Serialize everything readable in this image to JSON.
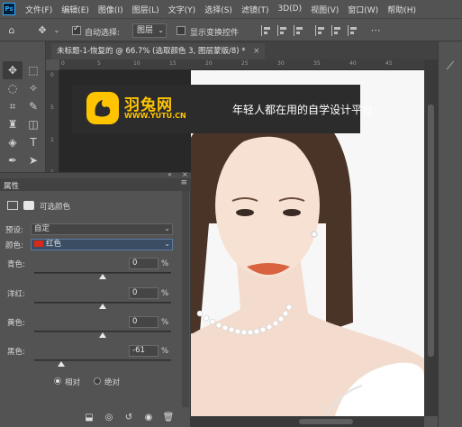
{
  "menu": {
    "logo": "Ps",
    "items": [
      "文件(F)",
      "编辑(E)",
      "图像(I)",
      "图层(L)",
      "文字(Y)",
      "选择(S)",
      "滤镜(T)",
      "3D(D)",
      "视图(V)",
      "窗口(W)",
      "帮助(H)"
    ]
  },
  "options": {
    "auto_select_label": "自动选择:",
    "auto_select_value": "图层",
    "show_transform_label": "显示变换控件"
  },
  "document": {
    "tab_title": "未标题-1-恢复的 @ 66.7% (选取颜色 3, 图层蒙版/8) *",
    "close": "×"
  },
  "rulers": {
    "h_ticks": [
      "0",
      "5",
      "10",
      "15",
      "20",
      "25",
      "30",
      "35",
      "40",
      "45"
    ],
    "v_ticks": [
      "0",
      "5",
      "1",
      "1",
      "5",
      "2",
      "0",
      "2",
      "5",
      "3",
      "0"
    ]
  },
  "banner": {
    "brand": "羽兔网",
    "url": "WWW.YUTU.CN",
    "slogan": "年轻人都在用的自学设计平台"
  },
  "properties": {
    "panel_title": "属性",
    "adjustment_name": "可选颜色",
    "preset_label": "预设:",
    "preset_value": "自定",
    "colors_label": "颜色:",
    "colors_value": "红色",
    "colors_swatch": "#d42a1a",
    "sliders": [
      {
        "label": "青色:",
        "value": "0",
        "unit": "%",
        "level": 0
      },
      {
        "label": "洋红:",
        "value": "0",
        "unit": "%",
        "level": 0
      },
      {
        "label": "黄色:",
        "value": "0",
        "unit": "%",
        "level": 0
      },
      {
        "label": "黑色:",
        "value": "-61",
        "unit": "%",
        "level": -61
      }
    ],
    "method_relative": "相对",
    "method_absolute": "绝对"
  }
}
